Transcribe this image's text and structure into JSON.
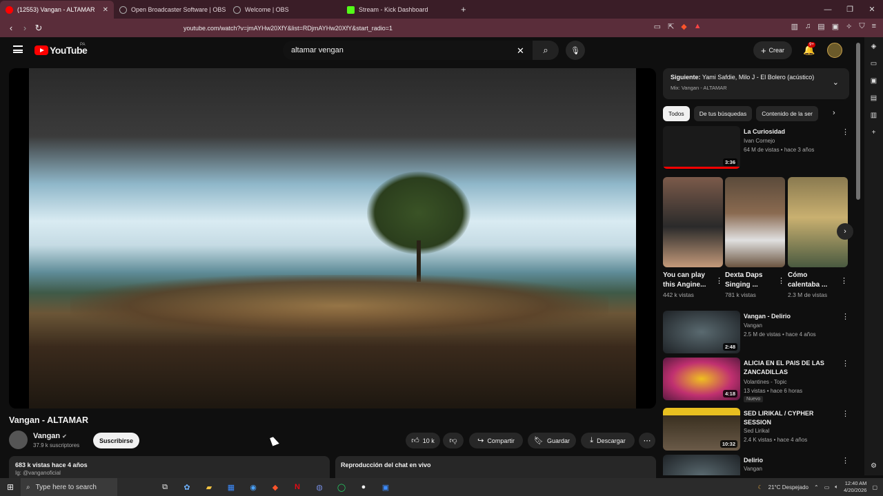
{
  "browser": {
    "tabs": [
      {
        "label": "(12553) Vangan - ALTAMAR",
        "active": true,
        "favicon_color": "#ff0000"
      },
      {
        "label": "Open Broadcaster Software | OBS",
        "active": false,
        "favicon_color": "#aaaaaa"
      },
      {
        "label": "Welcome | OBS",
        "active": false,
        "favicon_color": "#aaaaaa"
      },
      {
        "label": "Stream - Kick Dashboard",
        "active": false,
        "favicon_color": "#53fc18"
      }
    ],
    "url": "youtube.com/watch?v=jmAYHw20XfY&list=RDjmAYHw20XfY&start_radio=1"
  },
  "header": {
    "logo_text": "YouTube",
    "region": "PA",
    "search_value": "altamar vengan",
    "create_label": "Crear",
    "notif_count": "9+"
  },
  "video": {
    "title": "Vangan - ALTAMAR",
    "channel": "Vangan",
    "subscribers": "37.9 k suscriptores",
    "subscribe_label": "Suscribirse",
    "likes": "10 k",
    "share_label": "Compartir",
    "save_label": "Guardar",
    "download_label": "Descargar",
    "views_line": "683 k vistas  hace 4 años",
    "desc_line2": "Ig: @vanganoficial",
    "chat_label": "Reproducción del chat en vivo"
  },
  "sidebar": {
    "next_prefix": "Siguiente:",
    "next_title": "Yami Safdie, Milo J - El Bolero (acústico)",
    "next_mix": "Mix: Vangan - ALTAMAR",
    "chips": [
      "Todos",
      "De tus búsquedas",
      "Contenido de la ser"
    ],
    "recs_top": [
      {
        "title": "La Curiosidad",
        "channel": "Ivan Cornejo",
        "meta": "64 M de vistas • hace 3 años",
        "duration": "3:36",
        "thumb": "#1a1a1a",
        "progress": 1.0
      }
    ],
    "shorts": [
      {
        "title": "You can play this Angine...",
        "views": "442 k vistas",
        "thumb": "#7b5a4a"
      },
      {
        "title": "Dexta Daps Singing ...",
        "views": "781 k vistas",
        "thumb": "#5b4b3b"
      },
      {
        "title": "Cómo calentaba ...",
        "views": "2.3 M de vistas",
        "thumb": "#8a7a50"
      }
    ],
    "recs": [
      {
        "title": "Vangan - Delirio",
        "channel": "Vangan",
        "meta": "2.5 M de vistas • hace 4 años",
        "duration": "2:48",
        "thumb": "#2b2f33",
        "badge": ""
      },
      {
        "title": "ALICIA EN EL PAIS DE LAS ZANCADILLAS",
        "channel": "Volantines - Topic",
        "meta": "13 vistas • hace 6 horas",
        "duration": "4:18",
        "thumb": "#b03060",
        "badge": "Nuevo"
      },
      {
        "title": "SED LIRIKAL / CYPHER SESSION",
        "channel": "Sed Lirikal",
        "meta": "2.4 K vistas • hace 4 años",
        "duration": "10:32",
        "thumb": "#3a3020",
        "badge": ""
      },
      {
        "title": "Delirio",
        "channel": "Vangan",
        "meta": "",
        "duration": "",
        "thumb": "#2b2f33",
        "badge": ""
      }
    ]
  },
  "taskbar": {
    "search_placeholder": "Type here to search",
    "weather": "21°C  Despejado",
    "time": "12:40 AM",
    "date": "4/20/2026"
  }
}
